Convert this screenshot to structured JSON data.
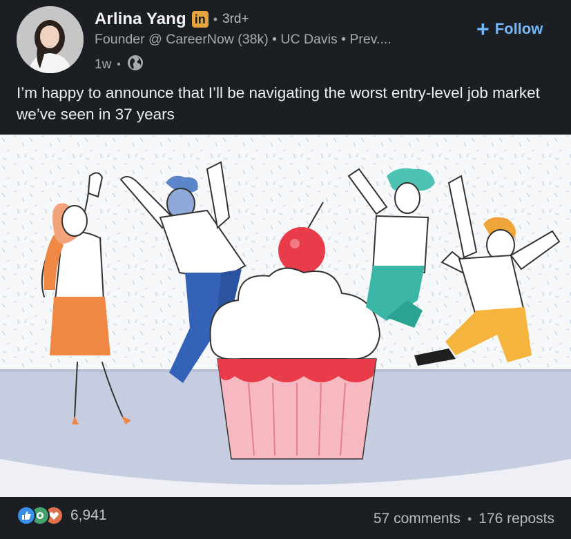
{
  "post": {
    "author": {
      "name": "Arlina Yang",
      "badge": "in",
      "degree": "3rd+",
      "headline": "Founder @ CareerNow (38k) • UC Davis • Prev....",
      "time": "1w",
      "visibility_icon": "globe-icon"
    },
    "follow_label": "Follow",
    "text": "I’m happy to announce that I’ll be navigating the worst entry-level job market we’ve seen in 37 years"
  },
  "footer": {
    "reaction_icons": [
      "like-icon",
      "celebrate-icon",
      "love-icon"
    ],
    "reaction_count": "6,941",
    "comments": "57 comments",
    "reposts": "176 reposts"
  },
  "colors": {
    "background": "#1b1f23",
    "accent": "#71b7fb",
    "badge": "#e7a33e"
  }
}
